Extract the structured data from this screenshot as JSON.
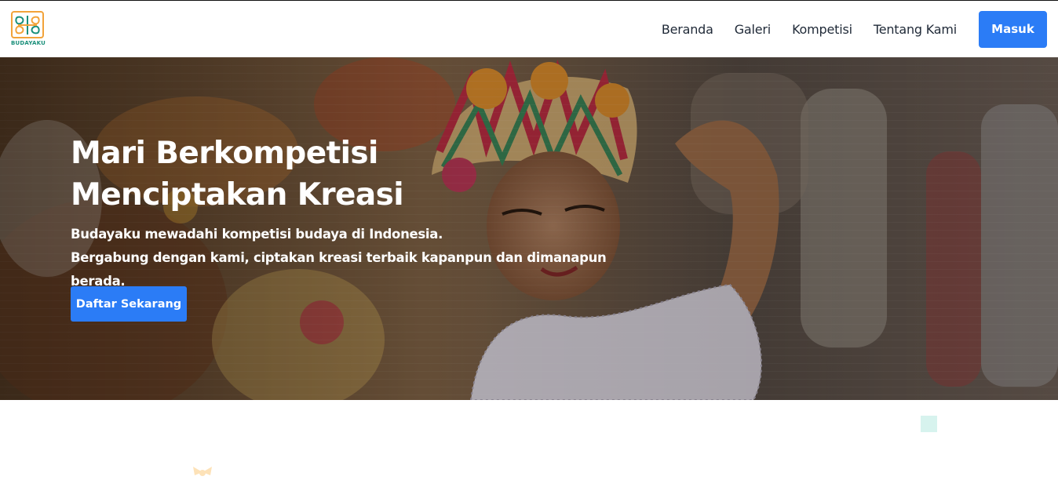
{
  "brand": {
    "logo_text": "BUDAYAKU",
    "logo_icon": "budayaku-logo-icon"
  },
  "nav": {
    "links": [
      "Beranda",
      "Galeri",
      "Kompetisi",
      "Tentang Kami"
    ],
    "login_label": "Masuk"
  },
  "hero": {
    "title_line1": "Mari Berkompetisi",
    "title_line2": "Menciptakan Kreasi",
    "desc_line1": "Budayaku mewadahi kompetisi budaya di Indonesia.",
    "desc_line2": "Bergabung dengan kami, ciptakan kreasi terbaik kapanpun dan dimanapun berada.",
    "cta_label": "Daftar Sekarang",
    "image": "balinese-dancer-photo"
  },
  "colors": {
    "accent": "#2b7cf6",
    "logo_green": "#1a8f7a",
    "logo_orange": "#f2a33a",
    "deco_mint": "#d7f3ee",
    "deco_peach": "#fde2b8"
  }
}
